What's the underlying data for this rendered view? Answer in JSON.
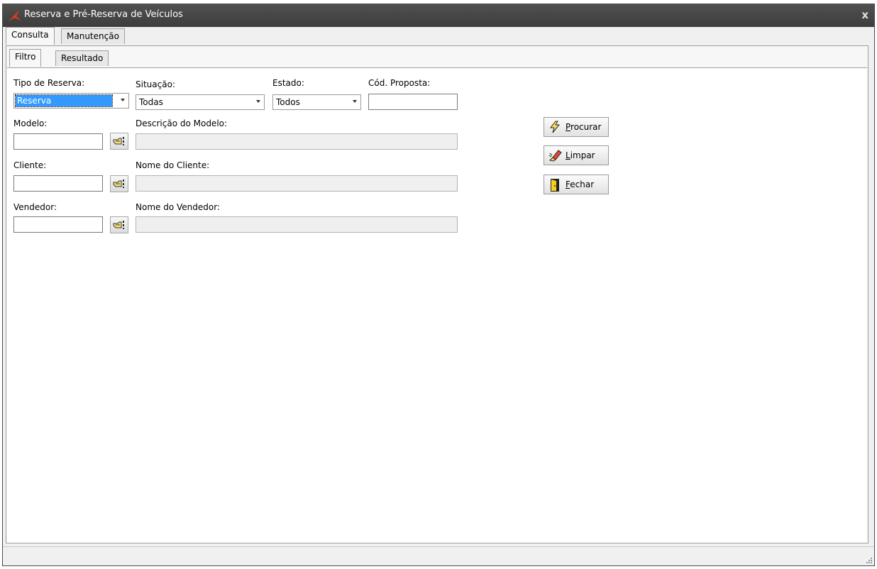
{
  "window": {
    "title": "Reserva e Pré-Reserva de Veículos",
    "close_label": "x"
  },
  "outer_tabs": [
    {
      "label": "Consulta"
    },
    {
      "label": "Manutenção"
    }
  ],
  "inner_tabs": [
    {
      "label": "Filtro"
    },
    {
      "label": "Resultado"
    }
  ],
  "filter": {
    "tipo_reserva": {
      "label": "Tipo de Reserva:",
      "value": "Reserva"
    },
    "situacao": {
      "label": "Situação:",
      "value": "Todas"
    },
    "estado": {
      "label": "Estado:",
      "value": "Todos"
    },
    "cod_proposta": {
      "label": "Cód. Proposta:",
      "value": ""
    },
    "modelo": {
      "label": "Modelo:",
      "value": ""
    },
    "descricao_modelo": {
      "label": "Descrição do Modelo:",
      "value": ""
    },
    "cliente": {
      "label": "Cliente:",
      "value": ""
    },
    "nome_cliente": {
      "label": "Nome do Cliente:",
      "value": ""
    },
    "vendedor": {
      "label": "Vendedor:",
      "value": ""
    },
    "nome_vendedor": {
      "label": "Nome do Vendedor:",
      "value": ""
    }
  },
  "actions": {
    "procurar": {
      "accel": "P",
      "rest": "rocurar"
    },
    "limpar": {
      "accel": "L",
      "rest": "impar"
    },
    "fechar": {
      "accel": "F",
      "rest": "echar"
    }
  },
  "colors": {
    "titlebar": "#3d3d3d",
    "selection": "#3399ff"
  },
  "icons": [
    "app-logo-icon",
    "close-icon",
    "lookup-hand-icon",
    "lightning-icon",
    "eraser-icon",
    "exit-door-icon",
    "resize-grip-icon"
  ]
}
